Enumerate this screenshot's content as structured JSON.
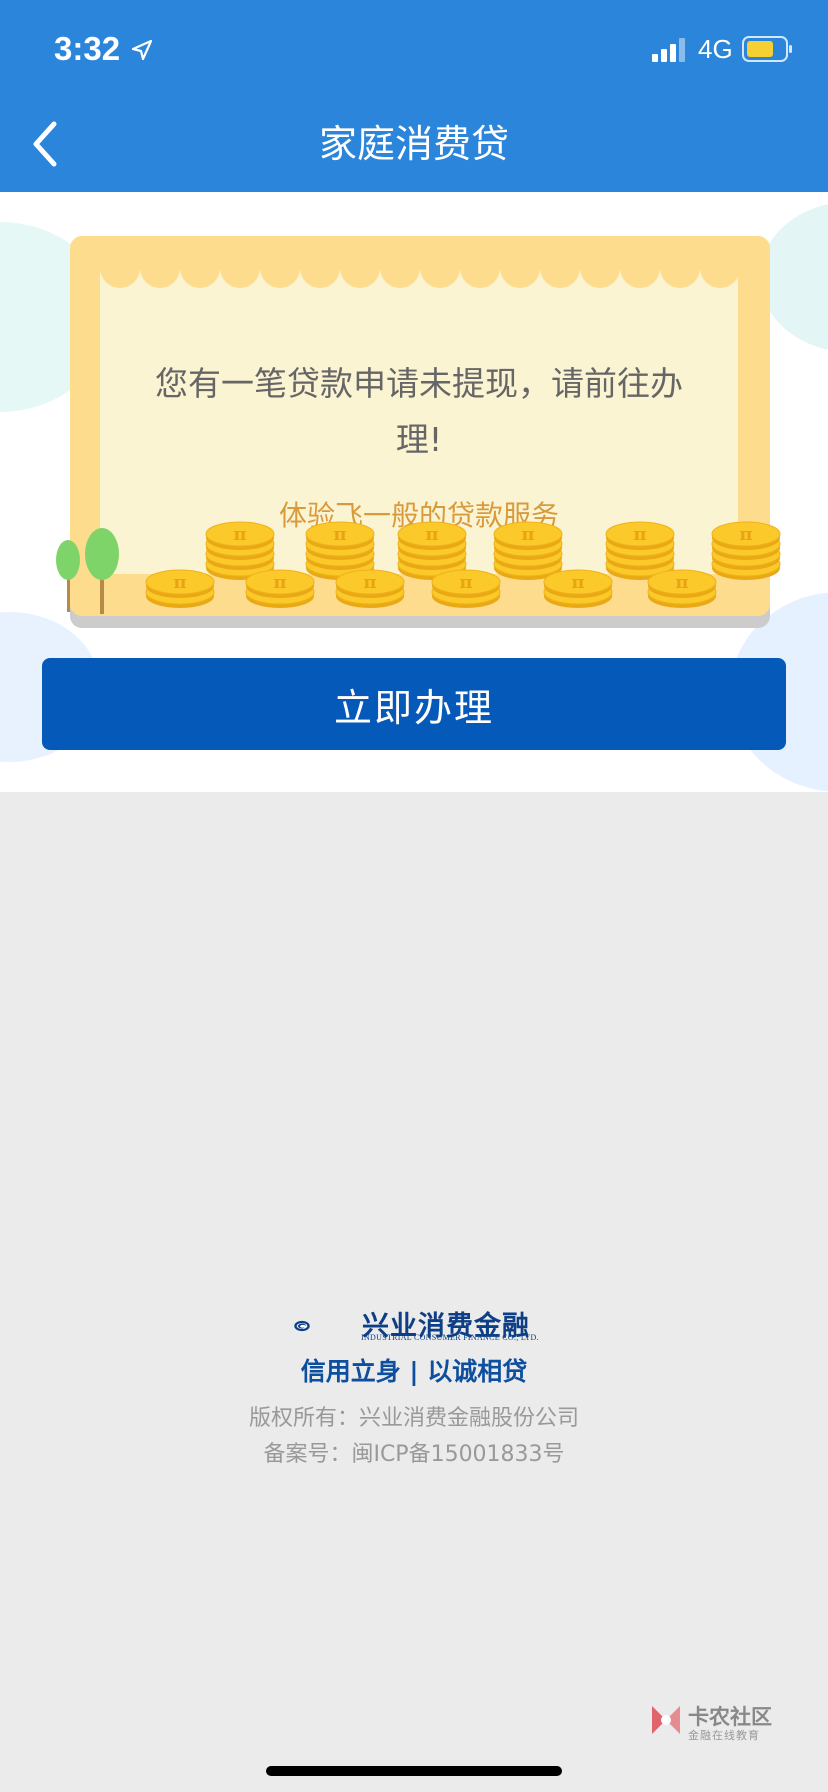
{
  "status_bar": {
    "time": "3:32",
    "network": "4G",
    "signal_icon": "signal-bars-icon",
    "battery_icon": "battery-icon",
    "location_icon": "location-arrow-icon"
  },
  "header": {
    "title": "家庭消费贷",
    "back_icon": "chevron-left-icon",
    "bg_color": "#2a85db"
  },
  "card": {
    "message": "您有一笔贷款申请未提现，请前往办理!",
    "subtitle": "体验飞一般的贷款服务",
    "coin_symbol": "π"
  },
  "primary_button": {
    "label": "立即办理",
    "color": "#0559b8"
  },
  "footer": {
    "logo_cn": "兴业消费金融",
    "logo_en": "INDUSTRIAL CONSUMER FINANCE CO., LTD.",
    "slogan": "信用立身 | 以诚相贷",
    "copyright": "版权所有：兴业消费金融股份公司",
    "icp": "备案号：闽ICP备15001833号"
  },
  "watermark": {
    "name": "卡农社区",
    "sub": "金融在线教育"
  }
}
